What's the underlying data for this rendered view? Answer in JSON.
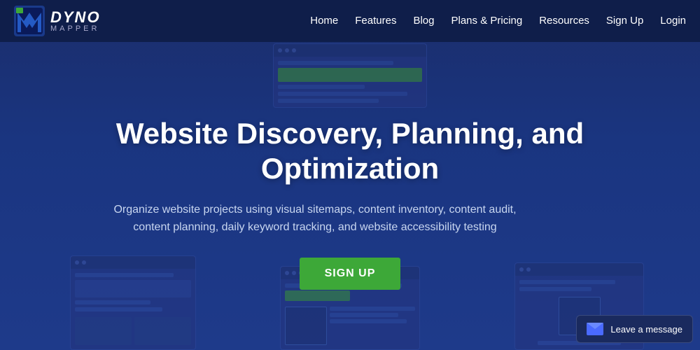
{
  "nav": {
    "logo": {
      "dyno": "DYNO",
      "mapper": "MAPPER",
      "registered": "®"
    },
    "links": [
      {
        "label": "Home",
        "href": "#",
        "active": true
      },
      {
        "label": "Features",
        "href": "#",
        "active": false
      },
      {
        "label": "Blog",
        "href": "#",
        "active": false
      },
      {
        "label": "Plans & Pricing",
        "href": "#",
        "active": false
      },
      {
        "label": "Resources",
        "href": "#",
        "active": false
      },
      {
        "label": "Sign Up",
        "href": "#",
        "active": false
      },
      {
        "label": "Login",
        "href": "#",
        "active": false
      }
    ]
  },
  "hero": {
    "title": "Website Discovery, Planning, and Optimization",
    "subtitle": "Organize website projects using visual sitemaps, content inventory, content audit, content planning, daily keyword tracking, and website accessibility testing",
    "cta_label": "SIGN UP"
  },
  "chat": {
    "label": "Leave a message"
  }
}
